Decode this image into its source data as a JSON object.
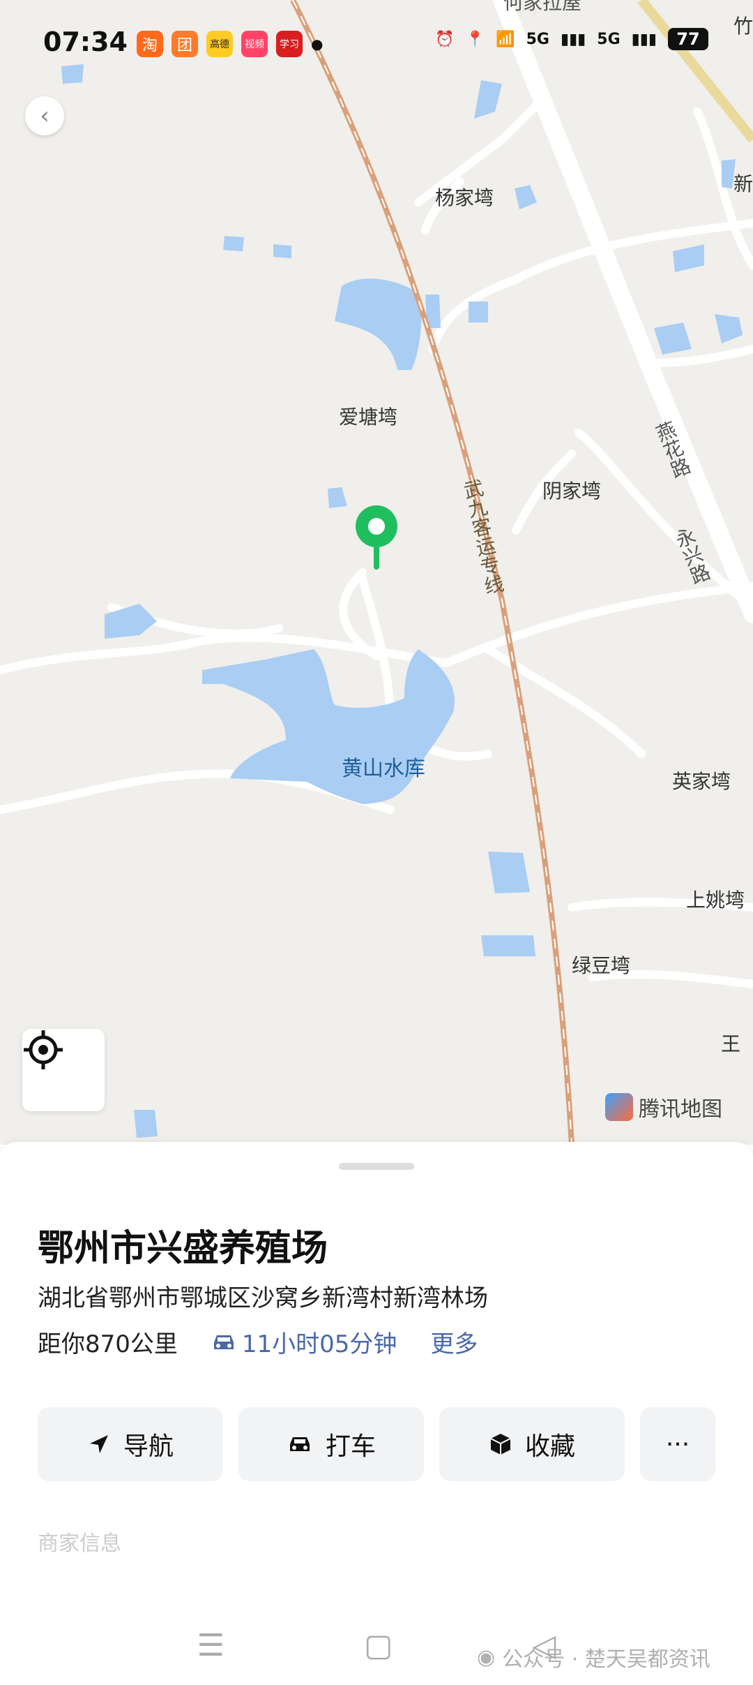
{
  "status_bar": {
    "time": "07:34",
    "app_icons": [
      "淘",
      "团",
      "高德",
      "视频",
      "学习"
    ],
    "network1": "5G",
    "network2": "5G",
    "battery": "77"
  },
  "map": {
    "labels": {
      "yangjiawan": "杨家塆",
      "aitangwan": "爱塘塆",
      "yinjiawan": "阴家塆",
      "huangshan_reservoir": "黄山水库",
      "yingjiawan": "英家塆",
      "shangyaowan": "上姚塆",
      "lvdouwan": "绿豆塆",
      "wang": "王",
      "top_cut": "何家拉屋",
      "xin": "新",
      "zhu": "竹"
    },
    "roads": {
      "rail": "武九客运专线",
      "yanhua": "燕花路",
      "yongxing": "永兴路"
    },
    "brand": "腾讯地图"
  },
  "place": {
    "title": "鄂州市兴盛养殖场",
    "address": "湖北省鄂州市鄂城区沙窝乡新湾村新湾林场",
    "distance": "距你870公里",
    "drive_time": "11小时05分钟",
    "more": "更多"
  },
  "actions": {
    "navigate": "导航",
    "taxi": "打车",
    "favorite": "收藏",
    "more": "···"
  },
  "section_hint": "商家信息",
  "watermark": "公众号 · 楚天吴都资讯",
  "colors": {
    "accent": "#4a68a8",
    "pin": "#1fbf5f",
    "water": "#a9cdf3",
    "rail": "#d9a07a"
  }
}
